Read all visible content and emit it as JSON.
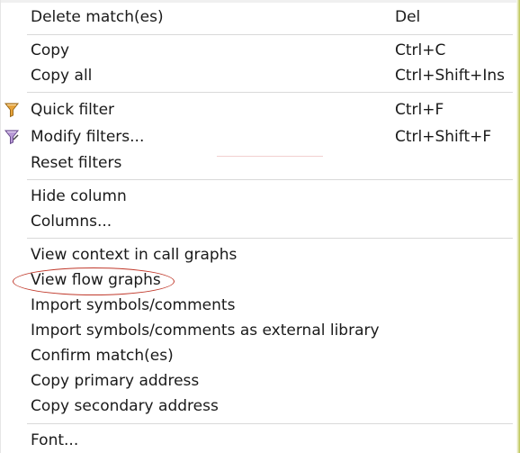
{
  "menu": {
    "items": [
      {
        "label": "Delete match(es)",
        "shortcut": "Del"
      },
      {
        "label": "Copy",
        "shortcut": "Ctrl+C"
      },
      {
        "label": "Copy all",
        "shortcut": "Ctrl+Shift+Ins"
      },
      {
        "label": "Quick filter",
        "shortcut": "Ctrl+F",
        "icon": "funnel-icon"
      },
      {
        "label": "Modify filters...",
        "shortcut": "Ctrl+Shift+F",
        "icon": "funnel-edit-icon"
      },
      {
        "label": "Reset filters",
        "shortcut": ""
      },
      {
        "label": "Hide column",
        "shortcut": ""
      },
      {
        "label": "Columns...",
        "shortcut": ""
      },
      {
        "label": "View context in call graphs",
        "shortcut": ""
      },
      {
        "label": "View flow graphs",
        "shortcut": "",
        "highlighted": true
      },
      {
        "label": "Import symbols/comments",
        "shortcut": ""
      },
      {
        "label": "Import symbols/comments as external library",
        "shortcut": ""
      },
      {
        "label": "Confirm match(es)",
        "shortcut": ""
      },
      {
        "label": "Copy primary address",
        "shortcut": ""
      },
      {
        "label": "Copy secondary address",
        "shortcut": ""
      },
      {
        "label": "Font...",
        "shortcut": ""
      }
    ]
  },
  "colors": {
    "funnel": "#e8a33a",
    "funnel_edit": "#8e6bbf",
    "highlight": "#c0392b"
  }
}
